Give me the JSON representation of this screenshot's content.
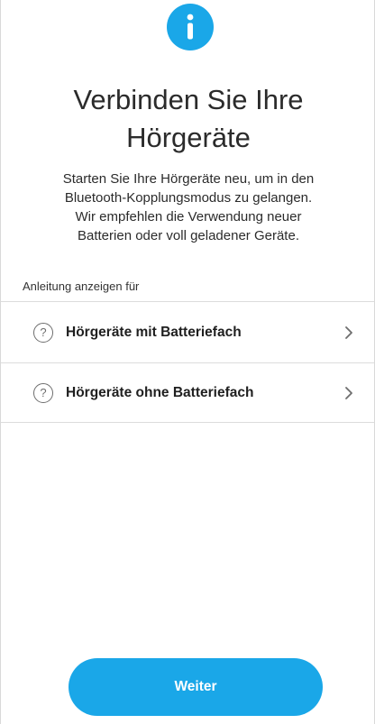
{
  "header": {
    "icon": "info-icon",
    "accent_color": "#1aa7e8",
    "title_line1": "Verbinden Sie Ihre",
    "title_line2": "Hörgeräte"
  },
  "description": {
    "line1": "Starten Sie Ihre Hörgeräte neu, um in den",
    "line2": "Bluetooth-Kopplungsmodus zu gelangen.",
    "line3": "Wir empfehlen die Verwendung neuer",
    "line4": "Batterien oder voll geladener Geräte."
  },
  "options": {
    "section_label": "Anleitung anzeigen für",
    "items": [
      {
        "icon": "help-circle-icon",
        "help_glyph": "?",
        "label": "Hörgeräte mit Batteriefach",
        "trailing_icon": "chevron-right-icon"
      },
      {
        "icon": "help-circle-icon",
        "help_glyph": "?",
        "label": "Hörgeräte ohne Batteriefach",
        "trailing_icon": "chevron-right-icon"
      }
    ]
  },
  "footer": {
    "continue_label": "Weiter"
  }
}
